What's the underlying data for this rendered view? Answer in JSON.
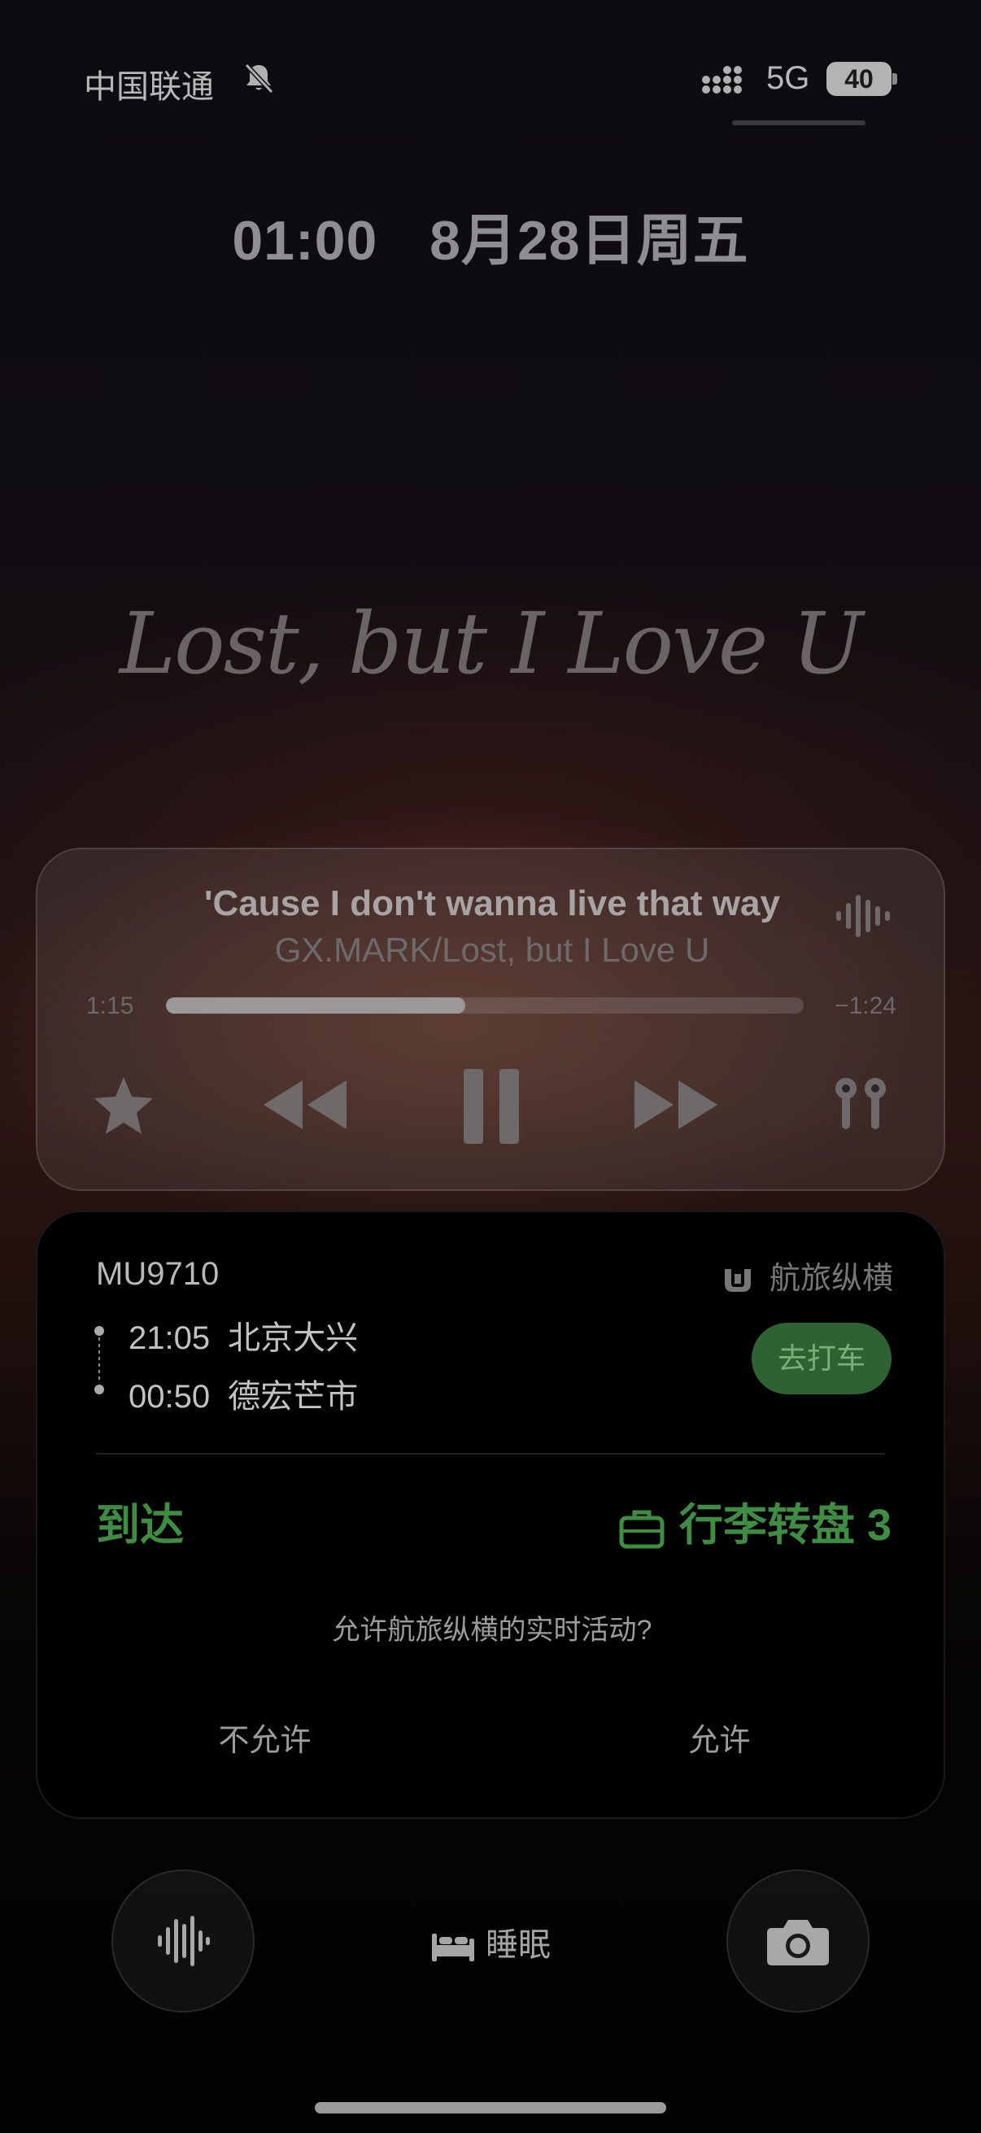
{
  "status_bar": {
    "carrier": "中国联通",
    "network": "5G",
    "battery": "40"
  },
  "lock": {
    "time": "01:00",
    "date": "8月28日周五"
  },
  "wallpaper": {
    "album_text": "Lost, but I Love U"
  },
  "now_playing": {
    "lyric": "'Cause I don't wanna live that way",
    "artist_track": "GX.MARK/Lost, but I Love U",
    "elapsed": "1:15",
    "remaining": "−1:24",
    "progress": 0.47
  },
  "live_activity": {
    "flight_no": "MU9710",
    "brand": "航旅纵横",
    "departure": {
      "time": "21:05",
      "city": "北京大兴"
    },
    "arrival": {
      "time": "00:50",
      "city": "德宏芒市"
    },
    "taxi_label": "去打车",
    "status": "到达",
    "baggage": "行李转盘 3",
    "prompt": "允许航旅纵横的实时活动?",
    "deny_label": "不允许",
    "allow_label": "允许"
  },
  "bottom": {
    "sleep_label": "睡眠"
  },
  "colors": {
    "accent_green": "#3f8d42",
    "taxi_button_bg": "#2f6232"
  }
}
